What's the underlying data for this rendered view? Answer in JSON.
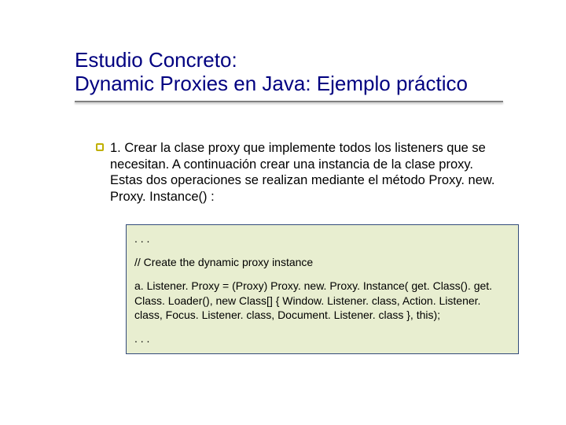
{
  "title": {
    "line1": "Estudio Concreto:",
    "line2": "Dynamic Proxies en Java: Ejemplo práctico"
  },
  "body": {
    "item1": "1. Crear la clase proxy que implemente todos los listeners que se necesitan. A continuación crear una instancia de la clase proxy. Estas dos operaciones se realizan mediante el método Proxy. new. Proxy. Instance() :"
  },
  "code": {
    "l1": ". . .",
    "l2": "// Create the dynamic proxy instance",
    "l3": "a. Listener. Proxy = (Proxy) Proxy. new. Proxy. Instance( get. Class(). get. Class. Loader(), new Class[] { Window. Listener. class, Action. Listener. class, Focus. Listener. class, Document. Listener. class }, this);",
    "l4": ". . ."
  }
}
